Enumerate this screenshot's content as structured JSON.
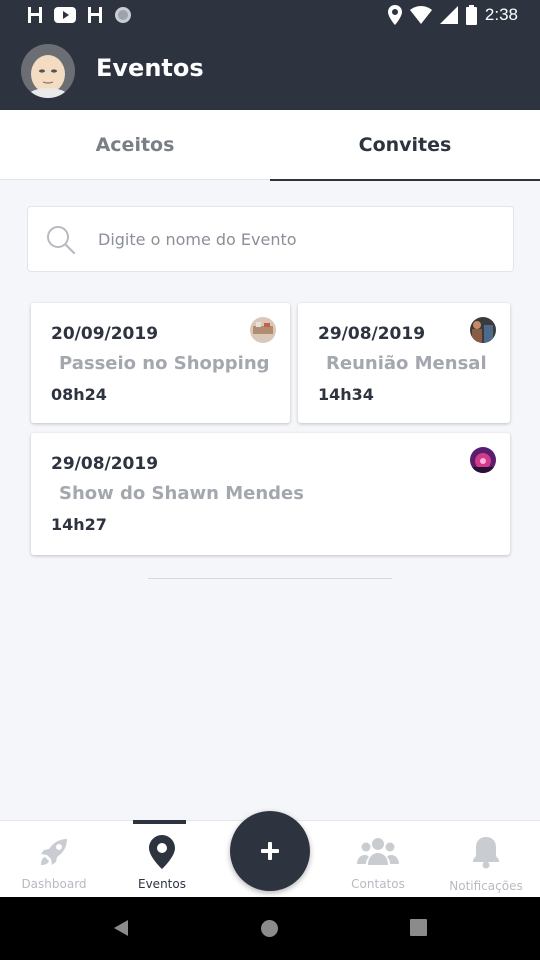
{
  "status_bar": {
    "time": "2:38"
  },
  "header": {
    "title": "Eventos"
  },
  "tabs": [
    {
      "label": "Aceitos",
      "active": false
    },
    {
      "label": "Convites",
      "active": true
    }
  ],
  "search": {
    "placeholder": "Digite o nome do Evento",
    "value": ""
  },
  "events": [
    {
      "date": "20/09/2019",
      "name": "Passeio no Shopping",
      "time": "08h24"
    },
    {
      "date": "29/08/2019",
      "name": "Reunião Mensal",
      "time": "14h34"
    },
    {
      "date": "29/08/2019",
      "name": "Show do Shawn Mendes",
      "time": "14h27"
    }
  ],
  "bottom_nav": {
    "items": [
      {
        "label": "Dashboard",
        "icon": "rocket-icon",
        "active": false
      },
      {
        "label": "Eventos",
        "icon": "map-pin-icon",
        "active": true
      },
      {
        "label": "Contatos",
        "icon": "people-icon",
        "active": false
      },
      {
        "label": "Notificações",
        "icon": "bell-icon",
        "active": false
      }
    ],
    "fab_icon": "plus-icon"
  },
  "colors": {
    "primary": "#2d3440",
    "muted": "#a3a7ae",
    "background": "#f5f6f9"
  }
}
